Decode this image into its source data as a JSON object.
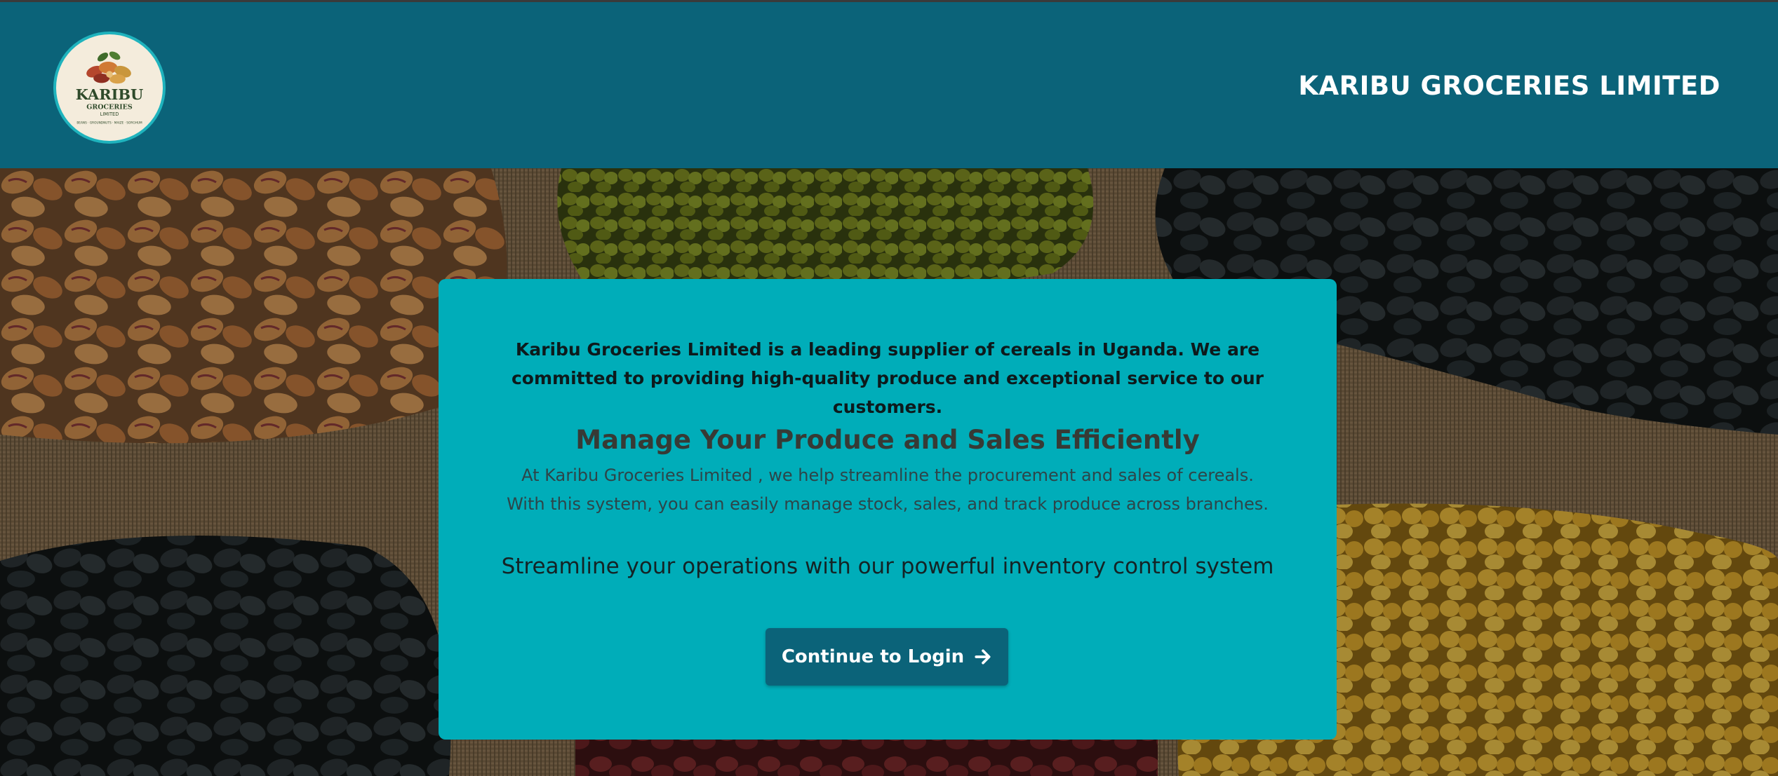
{
  "header": {
    "brand_title": "KARIBU GROCERIES LIMITED",
    "logo": {
      "name_line1": "KARIBU",
      "name_line2": "GROCERIES",
      "name_line3": "LIMITED",
      "arc_text": "BEANS · GROUNDNUTS · MAIZE · SORGHUM"
    }
  },
  "card": {
    "intro": "Karibu Groceries Limited is a leading supplier of cereals in Uganda. We are committed to providing high-quality produce and exceptional service to our customers.",
    "headline": "Manage Your Produce and Sales Efficiently",
    "description": "At Karibu Groceries Limited , we help streamline the procurement and sales of cereals. With this system, you can easily manage stock, sales, and track produce across branches.",
    "tagline": "Streamline your operations with our powerful inventory control system",
    "button_label": "Continue to Login",
    "button_icon": "arrow-right-icon"
  },
  "colors": {
    "header_bg": "#0b6379",
    "card_bg": "#00adb9",
    "button_bg": "#0b6379"
  }
}
